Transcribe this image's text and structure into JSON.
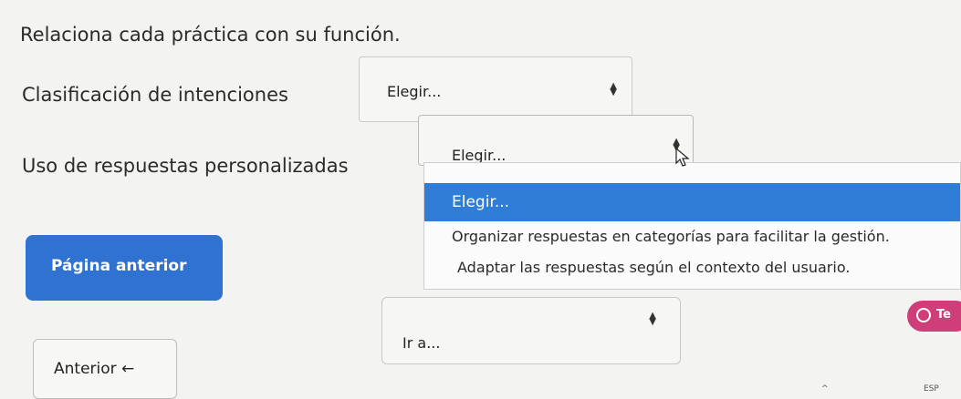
{
  "question": "Relaciona cada práctica con su función.",
  "rows": [
    {
      "label": "Clasificación de intenciones",
      "selected": "Elegir..."
    },
    {
      "label": "Uso de respuestas personalizadas",
      "selected": "Elegir..."
    }
  ],
  "dropdown": {
    "options": [
      "Elegir...",
      "Organizar respuestas en categorías para facilitar la gestión.",
      "Adaptar las respuestas según el contexto del usuario."
    ],
    "highlighted_index": 0
  },
  "nav": {
    "previous_page_label": "Página anterior",
    "goto_value": "Ir a...",
    "previous_label": "Anterior ←"
  },
  "chat": {
    "label": "Te"
  },
  "taskbar": {
    "lang": "ESP",
    "chevron": "^"
  },
  "colors": {
    "primary": "#2f72d2",
    "highlight": "#2f7dd6",
    "chat": "#cf3e78",
    "background": "#f3f3f1"
  }
}
